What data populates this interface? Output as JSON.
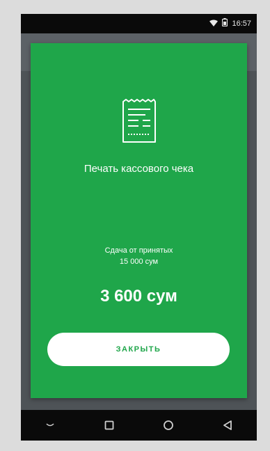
{
  "status_bar": {
    "time": "16:57",
    "icons": [
      "wifi-icon",
      "battery-icon"
    ]
  },
  "dialog": {
    "icon": "receipt-icon",
    "title": "Печать кассового чека",
    "caption_line1": "Сдача от принятых",
    "caption_line2": "15 000 сум",
    "amount": "3 600 сум",
    "close_label": "ЗАКРЫТЬ"
  },
  "nav_bar": {
    "items": [
      "hide-keyboard-icon",
      "recents-icon",
      "home-icon",
      "back-icon"
    ]
  },
  "colors": {
    "accent": "#1fa64a",
    "button_bg": "#ffffff"
  }
}
